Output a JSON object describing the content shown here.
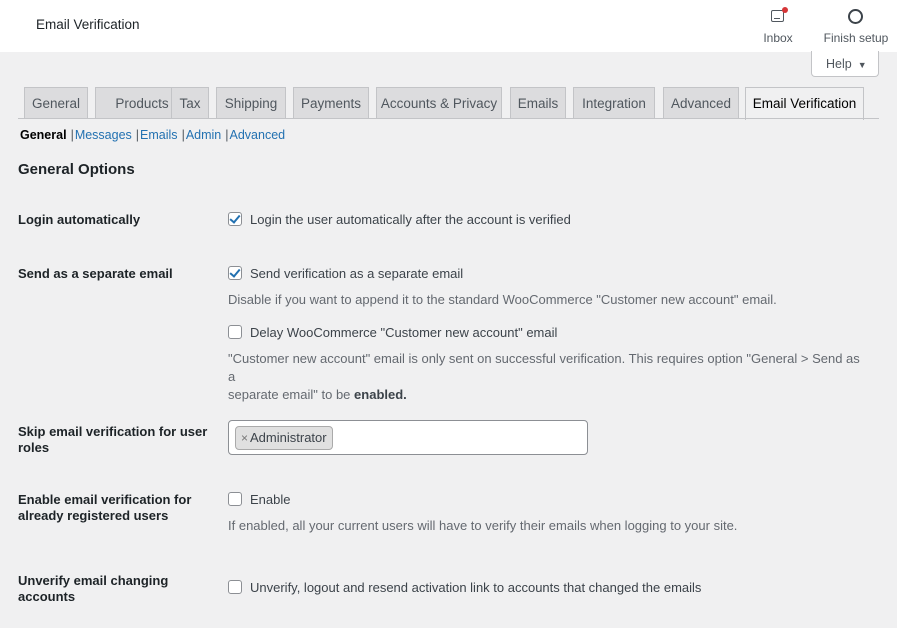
{
  "header": {
    "title": "Email Verification",
    "inbox_label": "Inbox",
    "finish_label": "Finish setup",
    "help_label": "Help"
  },
  "tabs": [
    {
      "label": "General"
    },
    {
      "label": "Products"
    },
    {
      "label": "Tax"
    },
    {
      "label": "Shipping"
    },
    {
      "label": "Payments"
    },
    {
      "label": "Accounts & Privacy"
    },
    {
      "label": "Emails"
    },
    {
      "label": "Integration"
    },
    {
      "label": "Advanced"
    },
    {
      "label": "Email Verification",
      "active": true
    }
  ],
  "subnav": {
    "current": "General",
    "links": [
      "Messages",
      "Emails",
      "Admin",
      "Advanced"
    ]
  },
  "section": {
    "title": "General Options"
  },
  "settings": {
    "login_auto": {
      "label": "Login automatically",
      "checkbox_label": "Login the user automatically after the account is verified",
      "checked": true
    },
    "separate_email": {
      "label": "Send as a separate email",
      "checkbox_label": "Send verification as a separate email",
      "checked": true,
      "desc": "Disable if you want to append it to the standard WooCommerce \"Customer new account\" email.",
      "delay_label": "Delay WooCommerce \"Customer new account\" email",
      "delay_checked": false,
      "delay_desc_line1": "\"Customer new account\" email is only sent on successful verification. This requires option \"General > Send as a",
      "delay_desc_line2": "separate email\" to be",
      "delay_desc_strong": "enabled."
    },
    "skip_roles": {
      "label_line1": "Skip email verification for user",
      "label_line2": "roles",
      "tokens": [
        "Administrator"
      ],
      "remove_glyph": "×"
    },
    "registered_users": {
      "label_line1": "Enable email verification for",
      "label_line2": "already registered users",
      "checkbox_label": "Enable",
      "checked": false,
      "desc": "If enabled, all your current users will have to verify their emails when logging to your site."
    },
    "unverify": {
      "label_line1": "Unverify email changing",
      "label_line2": "accounts",
      "checkbox_label": "Unverify, logout and resend activation link to accounts that changed the emails",
      "checked": false
    }
  },
  "colors": {
    "link": "#2271b1",
    "notification_dot": "#d63638",
    "background": "#f0f0f1"
  }
}
